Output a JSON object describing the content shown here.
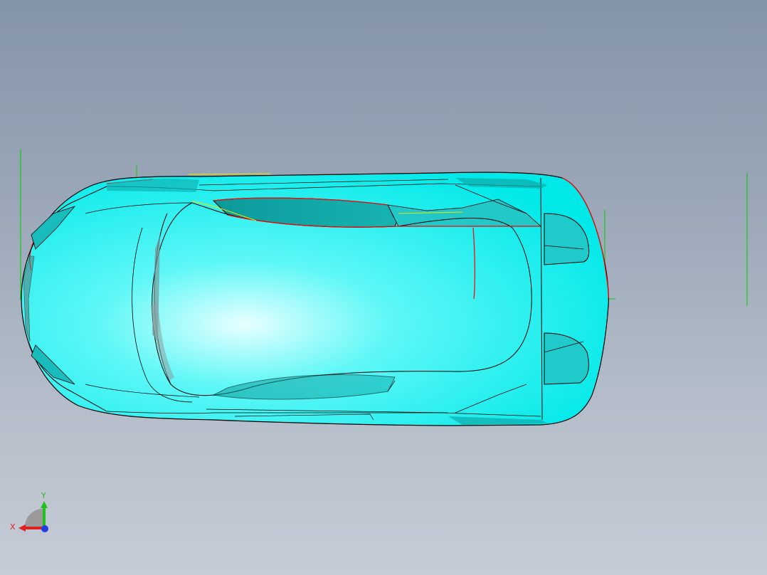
{
  "viewport": {
    "background_top": "#8494a8",
    "background_bottom": "#c6ccd6"
  },
  "model": {
    "surface_color": "#00f0f0",
    "edge_color": "#000000",
    "highlight_color": "#ff0000",
    "construction_color": "#00cc00",
    "accent_line_color": "#e6e600"
  },
  "triad": {
    "x_label": "X",
    "y_label": "Y",
    "x_color": "#e02020",
    "y_color": "#20c020",
    "z_color": "#2040e0"
  }
}
